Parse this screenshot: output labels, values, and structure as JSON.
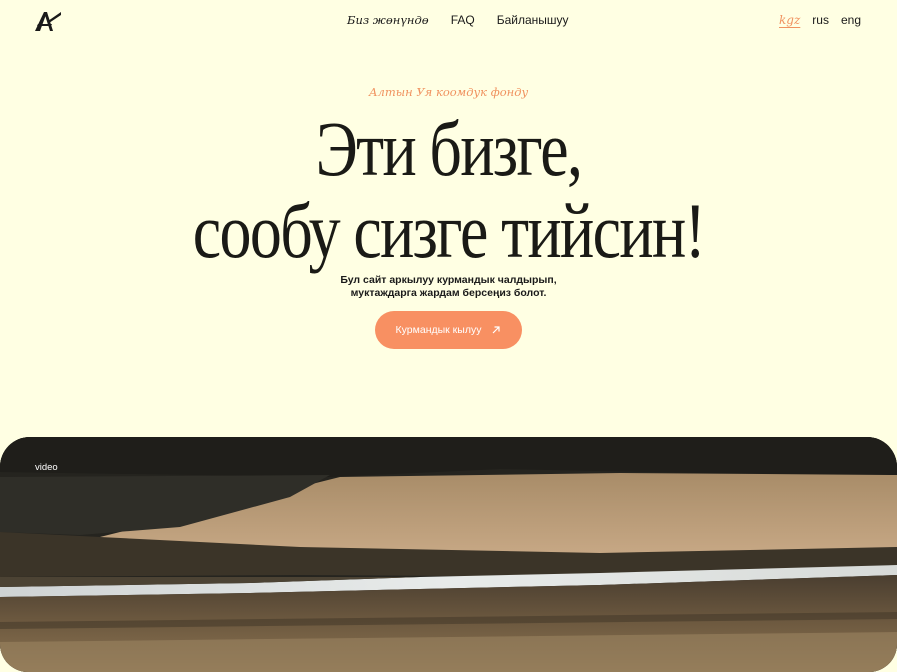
{
  "header": {
    "logo_name": "brand-logo",
    "nav": [
      {
        "label": "Биз жөнүндө"
      },
      {
        "label": "FAQ"
      },
      {
        "label": "Байланышуу"
      }
    ],
    "languages": [
      {
        "label": "kgz",
        "active": true
      },
      {
        "label": "rus",
        "active": false
      },
      {
        "label": "eng",
        "active": false
      }
    ]
  },
  "hero": {
    "eyebrow": "Алтын Уя коомдук фонду",
    "headline_line1": "Эти бизге,",
    "headline_line2": "сообу сизге тийсин!",
    "subtitle_line1": "Бул сайт аркылуу курмандык чалдырып,",
    "subtitle_line2": "муктаждарга жардам берсеңиз болот.",
    "cta_label": "Курмандык кылуу",
    "cta_icon": "arrow-up-right-icon"
  },
  "video": {
    "label": "video"
  },
  "colors": {
    "background": "#ffffe3",
    "accent": "#f89062",
    "text": "#1a1a1a"
  }
}
